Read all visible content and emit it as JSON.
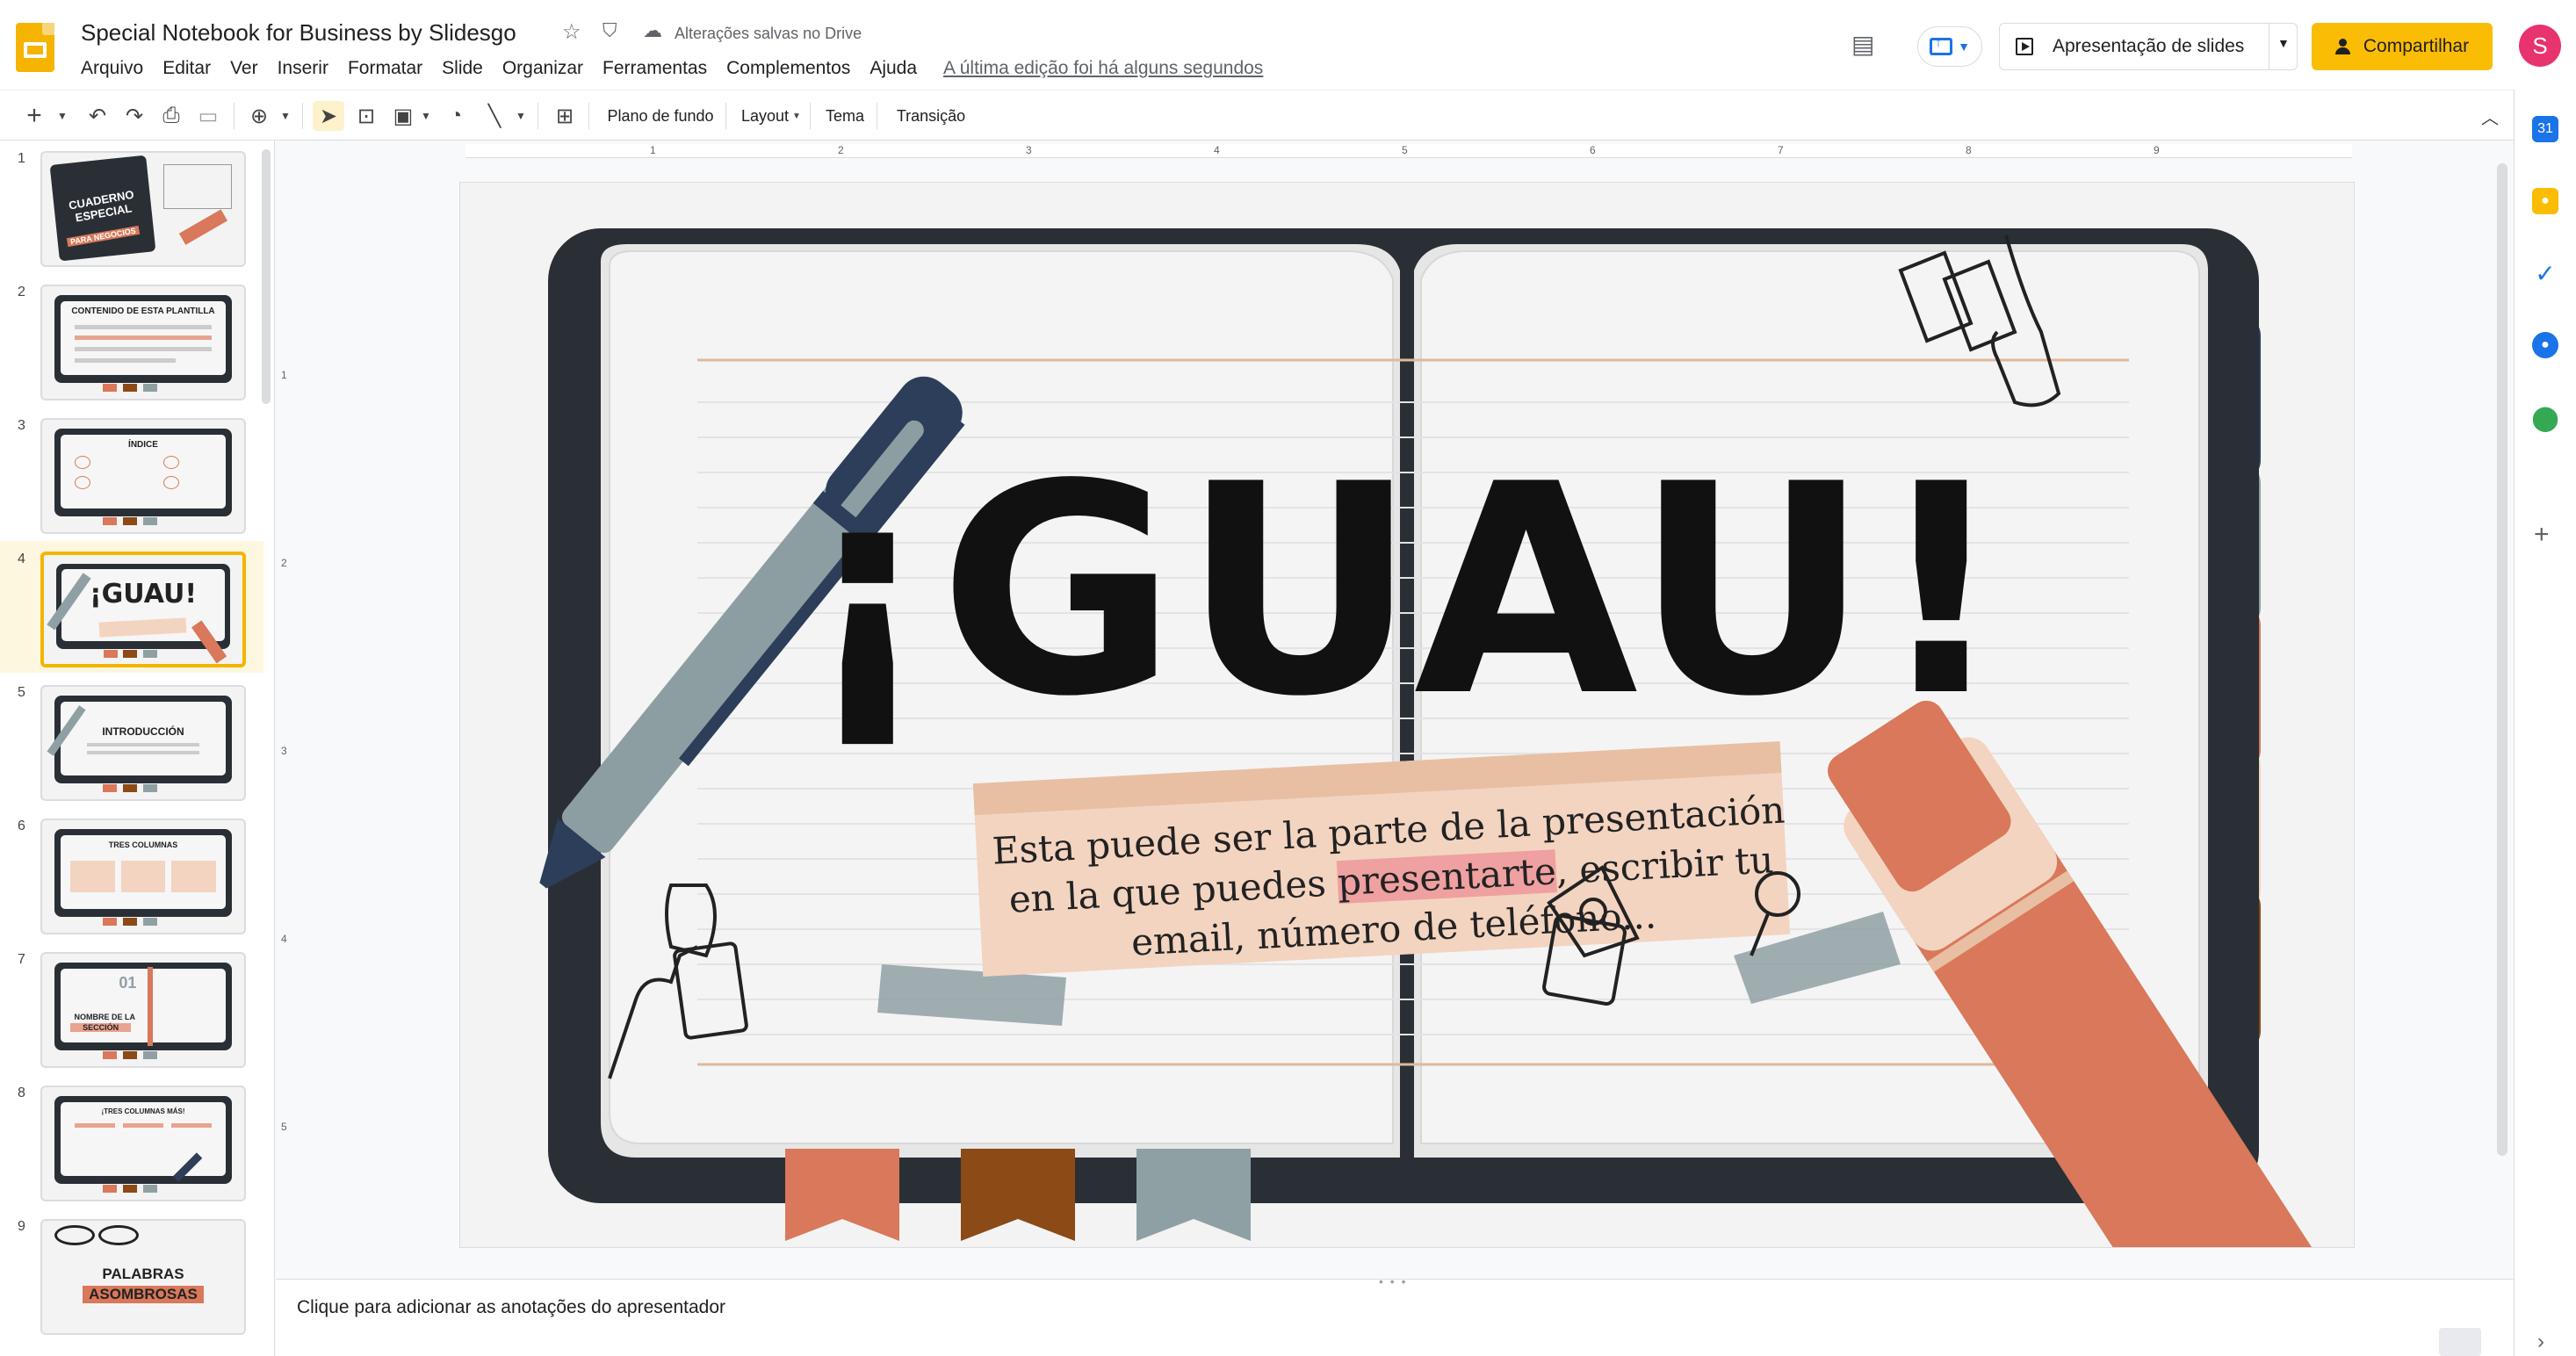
{
  "header": {
    "doc_title": "Special Notebook for Business by Slidesgo",
    "saved_status": "Alterações salvas no Drive",
    "menu": [
      "Arquivo",
      "Editar",
      "Ver",
      "Inserir",
      "Formatar",
      "Slide",
      "Organizar",
      "Ferramentas",
      "Complementos",
      "Ajuda"
    ],
    "last_edit": "A última edição foi há alguns segundos",
    "slideshow_label": "Apresentação de slides",
    "share_label": "Compartilhar",
    "avatar_initial": "S"
  },
  "toolbar": {
    "background": "Plano de fundo",
    "layout": "Layout",
    "theme": "Tema",
    "transition": "Transição"
  },
  "filmstrip": {
    "selected_index": 4,
    "slides": [
      {
        "num": "1",
        "title": "CUADERNO ESPECIAL",
        "highlight": "PARA NEGOCIOS"
      },
      {
        "num": "2",
        "title": "CONTENIDO DE ESTA PLANTILLA",
        "highlight": ""
      },
      {
        "num": "3",
        "title": "ÍNDICE",
        "highlight": ""
      },
      {
        "num": "4",
        "title": "¡GUAU!",
        "highlight": ""
      },
      {
        "num": "5",
        "title": "INTRODUCCIÓN",
        "highlight": ""
      },
      {
        "num": "6",
        "title": "TRES COLUMNAS",
        "highlight": ""
      },
      {
        "num": "7",
        "title": "NOMBRE DE LA",
        "highlight": "SECCIÓN"
      },
      {
        "num": "8",
        "title": "¡TRES COLUMNAS MÁS!",
        "highlight": ""
      },
      {
        "num": "9",
        "title": "PALABRAS",
        "highlight": "ASOMBROSAS"
      }
    ]
  },
  "ruler": {
    "h_ticks": [
      "1",
      "2",
      "3",
      "4",
      "5",
      "6",
      "7",
      "8",
      "9"
    ],
    "v_ticks": [
      "1",
      "2",
      "3",
      "4",
      "5"
    ]
  },
  "slide": {
    "title": "¡GUAU!",
    "body_before": "Esta puede ser la parte de la presentación en la que puedes ",
    "body_highlight": "presentarte",
    "body_after": ", escribir tu email, número de teléfono..."
  },
  "notes": {
    "placeholder": "Clique para adicionar as anotações do apresentador"
  },
  "colors": {
    "accent_yellow": "#fbbc04",
    "avatar": "#e8336e",
    "notebook_dark": "#2a2f36",
    "tab_terracotta": "#d9785a",
    "tab_brown": "#8b4a16",
    "tab_gray": "#8fa0a4",
    "tab_navy": "#2c3e5a",
    "tab_peach": "#f3d4c0"
  }
}
